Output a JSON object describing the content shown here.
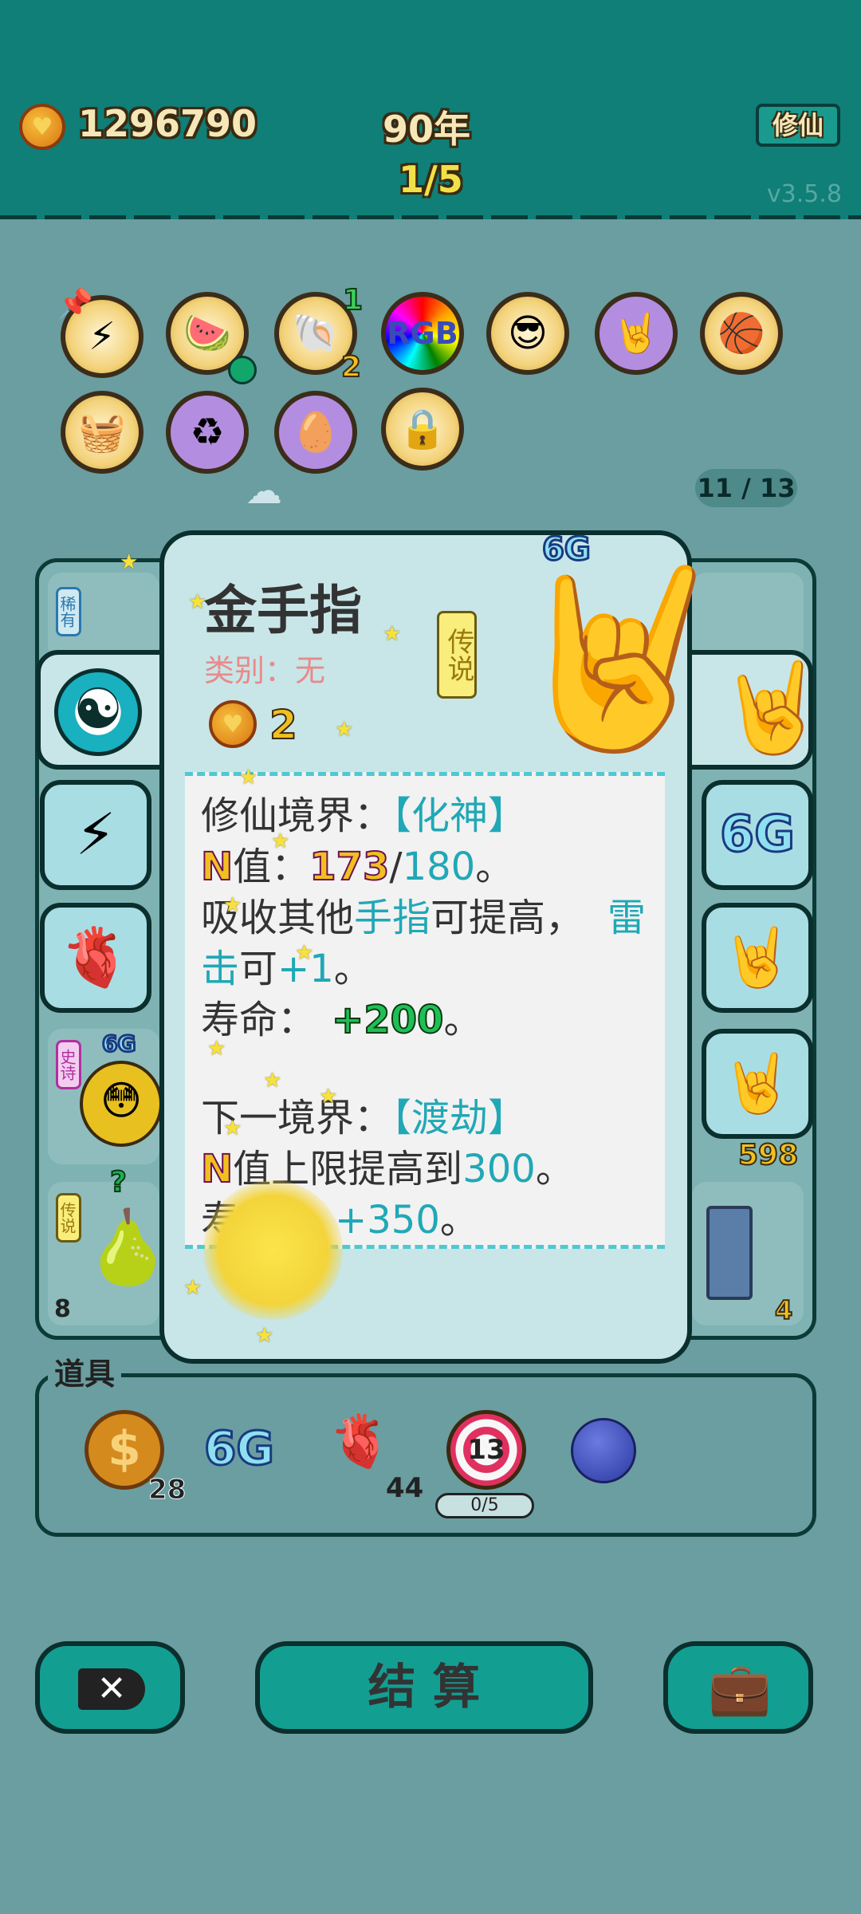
{
  "header": {
    "coins": "1296790",
    "year": "90年",
    "round": "1/5",
    "xiuxian_button": "修仙",
    "version": "v3.5.8"
  },
  "collection": {
    "count": "11 / 13",
    "badges": {
      "shell_top": "1",
      "shell_bottom": "2"
    }
  },
  "popup": {
    "title": "金手指",
    "category": "类别：无",
    "rarity": "传说",
    "cost": "2",
    "corner_tag": "6G",
    "desc": {
      "l1_a": "修仙境界：",
      "l1_b": "【化神】",
      "l2_a": "N",
      "l2_b": "值：",
      "l2_c": "173",
      "l2_d": "/",
      "l2_e": "180",
      "l2_f": "。",
      "l3_a": "吸收其他",
      "l3_b": "手指",
      "l3_c": "可提高，",
      "l3_d": "雷",
      "l4_a": "击",
      "l4_b": "可",
      "l4_c": "+1",
      "l4_d": "。",
      "l5_a": "寿命：",
      "l5_b": "+200",
      "l5_c": "。",
      "l6_a": "下一境界：",
      "l6_b": "【渡劫】",
      "l7_a": "N",
      "l7_b": "值上限提高到",
      "l7_c": "300",
      "l7_d": "。",
      "l8_a": "寿",
      "l8_b": "+350",
      "l8_c": "。"
    },
    "right_side": {
      "sixg": "6G"
    }
  },
  "board": {
    "left_tags": [
      "稀有",
      "史诗",
      "传说"
    ],
    "left_6g": "6G",
    "left_q": "?",
    "left_num": "8",
    "right_num_598": "598",
    "right_num_4": "4"
  },
  "items": {
    "title": "道具",
    "coin_count": "28",
    "sixg": "6G",
    "liver_count": "44",
    "target_label": "13",
    "target_progress": "0/5"
  },
  "bottom": {
    "settle": "结 算"
  }
}
